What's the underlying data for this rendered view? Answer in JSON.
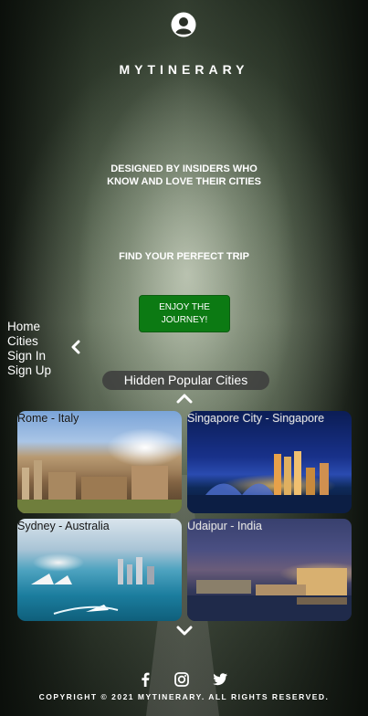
{
  "brand": {
    "name": "MYTINERARY"
  },
  "hero": {
    "tagline": "DESIGNED BY INSIDERS WHO\nKNOW AND LOVE THEIR CITIES",
    "subtitle": "FIND YOUR PERFECT TRIP",
    "cta_label": "ENJOY THE\nJOURNEY!"
  },
  "nav": {
    "items": [
      {
        "label": "Home"
      },
      {
        "label": "Cities"
      },
      {
        "label": "Sign In"
      },
      {
        "label": "Sign Up"
      }
    ]
  },
  "carousel": {
    "title": "Hidden Popular Cities",
    "cards": [
      {
        "label": "Rome - Italy"
      },
      {
        "label": "Singapore City - Singapore"
      },
      {
        "label": "Sydney - Australia"
      },
      {
        "label": "Udaipur - India"
      }
    ]
  },
  "footer": {
    "social": [
      "facebook-icon",
      "instagram-icon",
      "twitter-icon"
    ],
    "copyright": "COPYRIGHT © 2021 MYTINERARY. ALL RIGHTS RESERVED."
  },
  "colors": {
    "accent": "#0c7a13",
    "text": "#ffffff"
  }
}
